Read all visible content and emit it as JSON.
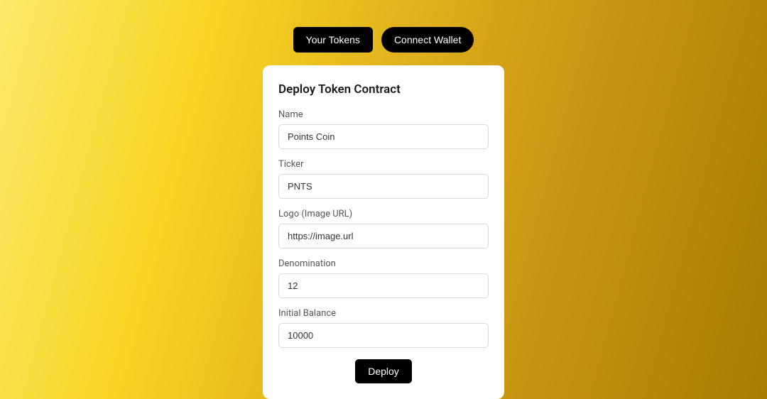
{
  "header": {
    "your_tokens": "Your Tokens",
    "connect_wallet": "Connect Wallet"
  },
  "form": {
    "title": "Deploy Token Contract",
    "name_label": "Name",
    "name_value": "Points Coin",
    "ticker_label": "Ticker",
    "ticker_value": "PNTS",
    "logo_label": "Logo (Image URL)",
    "logo_value": "https://image.url",
    "denomination_label": "Denomination",
    "denomination_value": "12",
    "balance_label": "Initial Balance",
    "balance_value": "10000",
    "deploy_button": "Deploy"
  }
}
